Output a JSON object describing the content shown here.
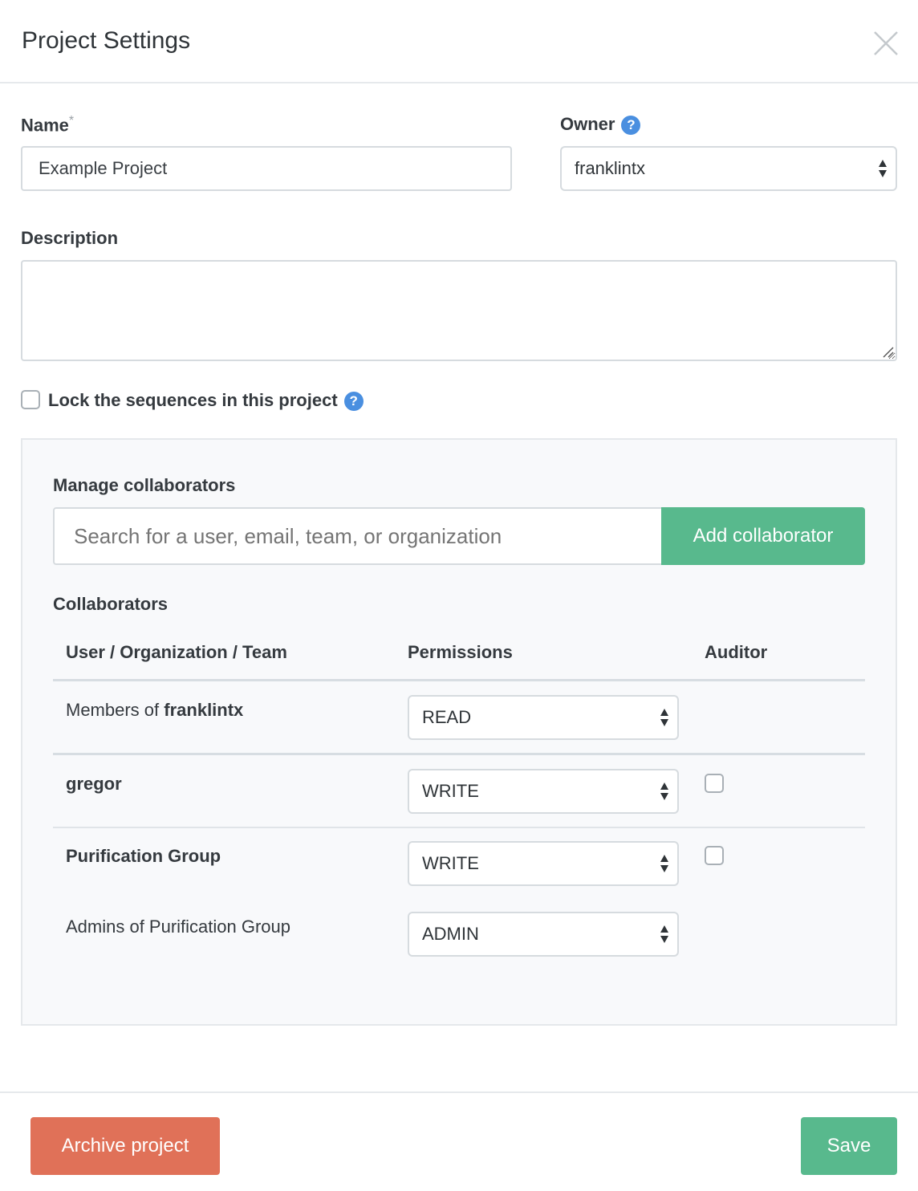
{
  "dialog": {
    "title": "Project Settings"
  },
  "form": {
    "name_label": "Name",
    "name_required": "*",
    "name_value": "Example Project",
    "owner_label": "Owner",
    "owner_value": "franklintx",
    "description_label": "Description",
    "description_value": "",
    "lock_label": "Lock the sequences in this project"
  },
  "collaborators": {
    "manage_label": "Manage collaborators",
    "search_placeholder": "Search for a user, email, team, or organization",
    "add_button": "Add collaborator",
    "section_label": "Collaborators",
    "headers": {
      "who": "User / Organization / Team",
      "permissions": "Permissions",
      "auditor": "Auditor"
    },
    "rows": [
      {
        "prefix": "Members of ",
        "name": "franklintx",
        "permission": "READ"
      },
      {
        "name": "gregor",
        "permission": "WRITE"
      },
      {
        "name": "Purification Group",
        "permission": "WRITE"
      },
      {
        "name": "Admins of Purification Group",
        "permission": "ADMIN"
      }
    ]
  },
  "footer": {
    "archive_button": "Archive project",
    "save_button": "Save"
  },
  "colors": {
    "accent_green": "#58b98d",
    "danger_red": "#e07158",
    "help_blue": "#4a8fe0"
  }
}
